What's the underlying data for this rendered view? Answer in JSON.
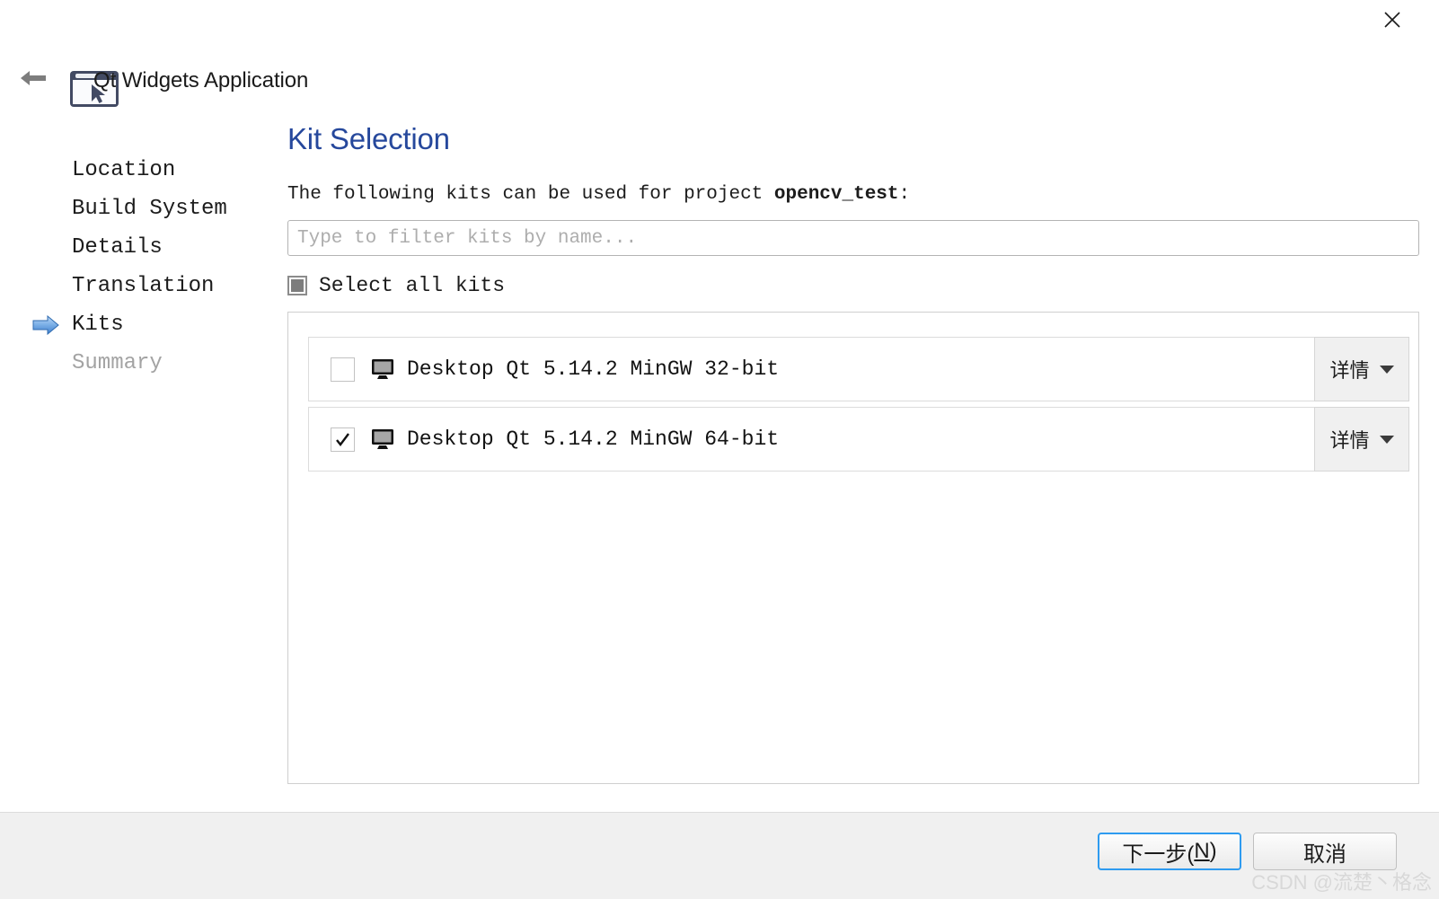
{
  "window": {
    "title": "Qt Widgets Application",
    "close_icon": "close-icon",
    "back_icon": "back-arrow-icon",
    "type_icon": "qt-widgets-application-icon"
  },
  "steps": [
    {
      "label": "Location",
      "state": "done"
    },
    {
      "label": "Build System",
      "state": "done"
    },
    {
      "label": "Details",
      "state": "done"
    },
    {
      "label": "Translation",
      "state": "done"
    },
    {
      "label": "Kits",
      "state": "current"
    },
    {
      "label": "Summary",
      "state": "upcoming"
    }
  ],
  "page": {
    "heading": "Kit Selection",
    "description_prefix": "The following kits can be used for project ",
    "project_name": "opencv_test",
    "description_suffix": ":"
  },
  "filter": {
    "placeholder": "Type to filter kits by name...",
    "value": ""
  },
  "select_all": {
    "label": "Select all kits",
    "state": "partially-checked"
  },
  "kits": [
    {
      "name": "Desktop Qt 5.14.2 MinGW 32-bit",
      "checked": false,
      "device_icon": "desktop-monitor-icon",
      "details_label": "详情"
    },
    {
      "name": "Desktop Qt 5.14.2 MinGW 64-bit",
      "checked": true,
      "device_icon": "desktop-monitor-icon",
      "details_label": "详情"
    }
  ],
  "footer": {
    "next_label_prefix": "下一步(",
    "next_accel": "N",
    "next_label_suffix": ")",
    "cancel_label": "取消"
  },
  "watermark": "CSDN @流楚丶格念",
  "colors": {
    "heading": "#26489c",
    "default_button_border": "#2e9bf0",
    "step_current_marker": "#4f8fd6",
    "footer_background": "#f0f0f0"
  }
}
